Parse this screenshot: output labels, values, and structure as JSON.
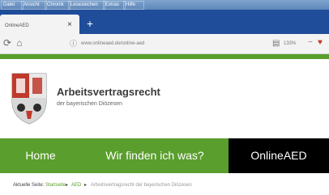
{
  "window": {
    "menu_items": [
      "Datei",
      "Ansicht",
      "Chronik",
      "Lesezeichen",
      "Extras",
      "Hilfe"
    ]
  },
  "tab": {
    "title": "OnlineAED",
    "close": "×",
    "new_tab": "+"
  },
  "address_bar": {
    "url": "www.onlineaed.de/online-aed",
    "zoom": "133%"
  },
  "site": {
    "title": "Arbeitsvertragsrecht",
    "subtitle": "der bayerischen Diözesen"
  },
  "nav": {
    "items": [
      "Home",
      "Wir finden ich was?",
      "OnlineAED"
    ],
    "active": "OnlineAED"
  },
  "breadcrumb": {
    "label": "Aktuelle Seite:",
    "home": "Startseite",
    "sep": "▸",
    "section": "AED",
    "current": "Arbeitsvertragsrecht der bayerischen Diözesen"
  },
  "colors": {
    "brand_green": "#5a9e2d",
    "tab_bar_blue": "#1f4d9a",
    "active_nav": "#000000"
  },
  "icons": [
    "reload-icon",
    "home-icon",
    "lock-icon",
    "reader-view-icon",
    "bookmark-icon",
    "close-icon",
    "new-tab-icon",
    "coat-of-arms-logo"
  ]
}
